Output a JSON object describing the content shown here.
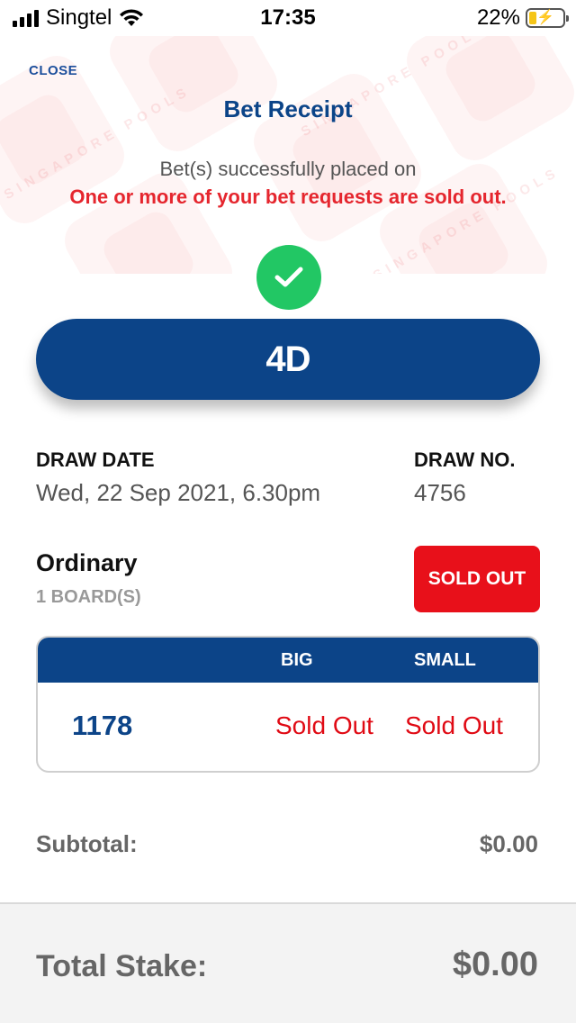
{
  "status_bar": {
    "carrier": "Singtel",
    "time": "17:35",
    "battery_percent": "22%",
    "battery_level": 0.22,
    "icons": [
      "cellular-signal-icon",
      "wifi-icon",
      "battery-charging-icon"
    ]
  },
  "header": {
    "close_label": "CLOSE",
    "title": "Bet Receipt",
    "success_message": "Bet(s) successfully placed on",
    "soldout_message": "One or more of your bet requests are sold out.",
    "status_icon": "checkmark-icon",
    "watermark_text": "SINGAPORE POOLS"
  },
  "game": {
    "name": "4D"
  },
  "draw": {
    "date_label": "DRAW DATE",
    "date_value": "Wed, 22 Sep 2021, 6.30pm",
    "number_label": "DRAW NO.",
    "number_value": "4756"
  },
  "bet": {
    "type": "Ordinary",
    "boards": "1 BOARD(S)",
    "status_badge": "SOLD OUT",
    "columns": [
      "",
      "BIG",
      "SMALL"
    ],
    "rows": [
      {
        "number": "1178",
        "big": "Sold Out",
        "small": "Sold Out"
      }
    ]
  },
  "summary": {
    "subtotal_label": "Subtotal:",
    "subtotal_value": "$0.00",
    "total_label": "Total Stake:",
    "total_value": "$0.00"
  },
  "colors": {
    "primary_blue": "#0c4488",
    "alert_red": "#e5262e",
    "success_green": "#22c764"
  }
}
